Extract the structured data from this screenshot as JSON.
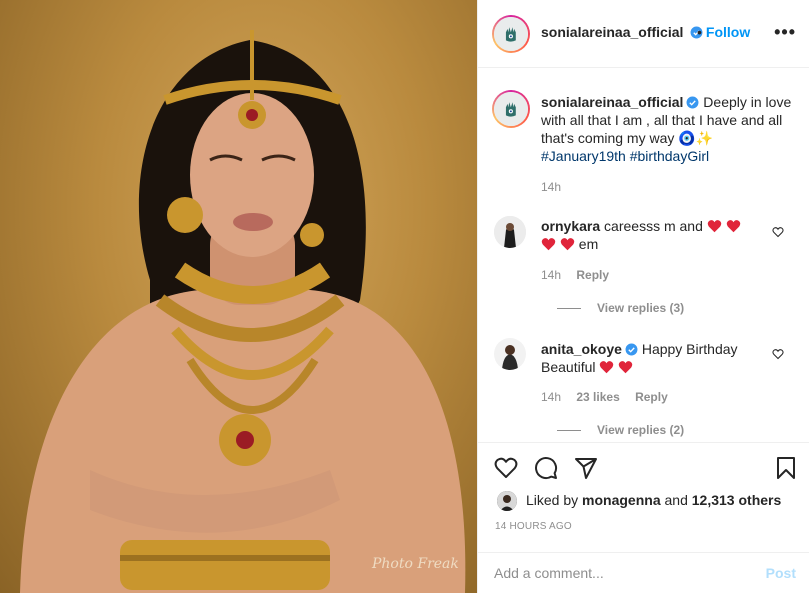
{
  "post": {
    "author": "sonialareinaa_official",
    "follow_label": "Follow",
    "dot": "•",
    "more_label": "•••",
    "caption_text": "Deeply in love with all that I am , all that I have and all that's coming my way 🧿✨",
    "hashtags": [
      "#January19th",
      "#birthdayGirl"
    ],
    "caption_time": "14h",
    "photo_signature": "Photo Freak"
  },
  "comments": [
    {
      "user": "ornykara",
      "text_before": "careesss m and",
      "text_after": "em",
      "time": "14h",
      "likes": "",
      "reply_label": "Reply",
      "view_replies": "View replies (3)"
    },
    {
      "user": "anita_okoye",
      "text_before": "Happy Birthday Beautiful",
      "text_after": "",
      "time": "14h",
      "likes": "23 likes",
      "reply_label": "Reply",
      "view_replies": "View replies (2)"
    }
  ],
  "likes": {
    "prefix": "Liked by",
    "user": "monagenna",
    "joiner": "and",
    "others": "12,313 others"
  },
  "timestamp": "14 HOURS AGO",
  "add_comment": {
    "placeholder": "Add a comment...",
    "post_label": "Post"
  },
  "colors": {
    "accent": "#0095f6",
    "hashtag": "#00376b",
    "muted": "#8e8e8e",
    "heart": "#ed4956",
    "post_disabled": "#b2dffc"
  },
  "icons": [
    "heart-icon",
    "comment-icon",
    "share-icon",
    "bookmark-icon",
    "verified-icon",
    "more-icon",
    "hamsa-icon"
  ]
}
